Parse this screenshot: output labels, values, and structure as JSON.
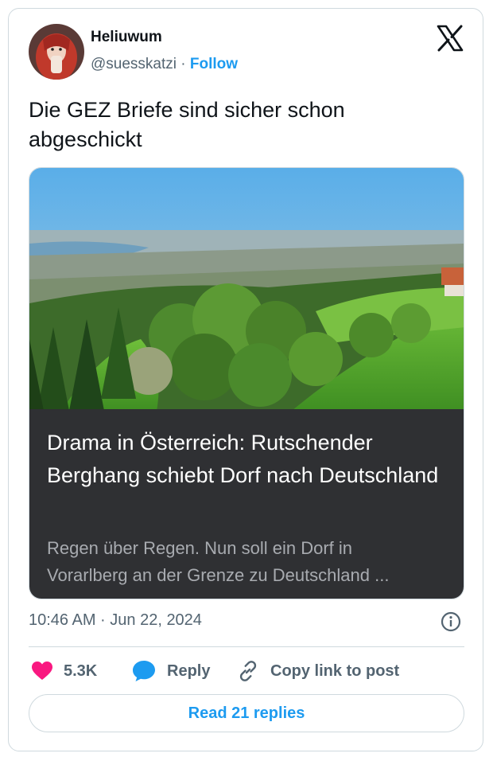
{
  "author": {
    "display_name": "Heliuwum",
    "handle": "@suesskatzi",
    "separator": "·",
    "follow_label": "Follow"
  },
  "tweet": {
    "text": "Die GEZ Briefe sind sicher schon abgeschickt",
    "timestamp": "10:46 AM · Jun 22, 2024"
  },
  "article": {
    "title": "Drama in Österreich: Rutschender Berghang schiebt Dorf nach Deutschland",
    "description_line1": "Regen über Regen. Nun soll ein Dorf in",
    "description_line2": "Vorarlberg an der Grenze zu Deutschland ..."
  },
  "actions": {
    "likes": "5.3K",
    "reply_label": "Reply",
    "copy_label": "Copy link to post"
  },
  "footer": {
    "read_replies_label": "Read 21 replies"
  },
  "icons": {
    "brand_logo": "x-logo-icon",
    "info": "info-icon",
    "like": "heart-icon",
    "reply": "speech-bubble-icon",
    "copy": "link-icon"
  },
  "colors": {
    "accent": "#1d9bf0",
    "like": "#f91880",
    "reply_icon": "#1d9bf0",
    "text": "#0f1419",
    "secondary_text": "#536471",
    "article_panel": "#2f3033"
  }
}
